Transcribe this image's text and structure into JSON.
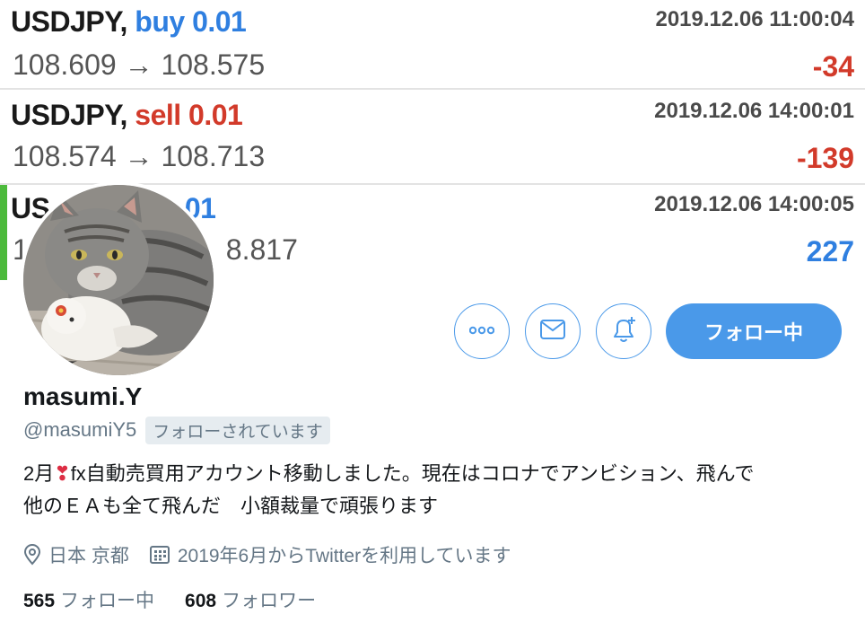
{
  "trades": [
    {
      "pair": "USDJPY,",
      "side": "buy",
      "lot": "0.01",
      "prices": "108.609 → 108.575",
      "time": "2019.12.06 11:00:04",
      "pnl": "-34"
    },
    {
      "pair": "USDJPY,",
      "side": "sell",
      "lot": "0.01",
      "prices": "108.574 → 108.713",
      "time": "2019.12.06 14:00:01",
      "pnl": "-139"
    },
    {
      "pair_visible": "US",
      "lot_visible": ".01",
      "prices_visible": "1",
      "prices_tail": "8.817",
      "time": "2019.12.06 14:00:05",
      "pnl": "227"
    }
  ],
  "profile": {
    "name": "masumi.Y",
    "handle": "@masumiY5",
    "follows_you": "フォローされています",
    "follow_button": "フォロー中",
    "bio_prefix": "2月",
    "bio_heart": "❣",
    "bio_line1": "fx自動売買用アカウント移動しました。現在はコロナでアンビション、飛んで",
    "bio_line2": "他のＥＡも全て飛んだ　小額裁量で頑張ります",
    "location": "日本 京都",
    "joined": "2019年6月からTwitterを利用しています",
    "following_count": "565",
    "following_label": "フォロー中",
    "followers_count": "608",
    "followers_label": "フォロワー"
  },
  "icons": {
    "more": "more-icon",
    "message": "envelope-icon",
    "notify": "bell-plus-icon",
    "location": "location-pin-icon",
    "calendar": "calendar-icon"
  },
  "colors": {
    "accent": "#4a99e9",
    "buy": "#2f7fe0",
    "sell": "#d23a2a",
    "loss": "#d23a2a",
    "profit": "#2f7fe0",
    "active_trade": "#4cba3c",
    "secondary_text": "#657786"
  }
}
